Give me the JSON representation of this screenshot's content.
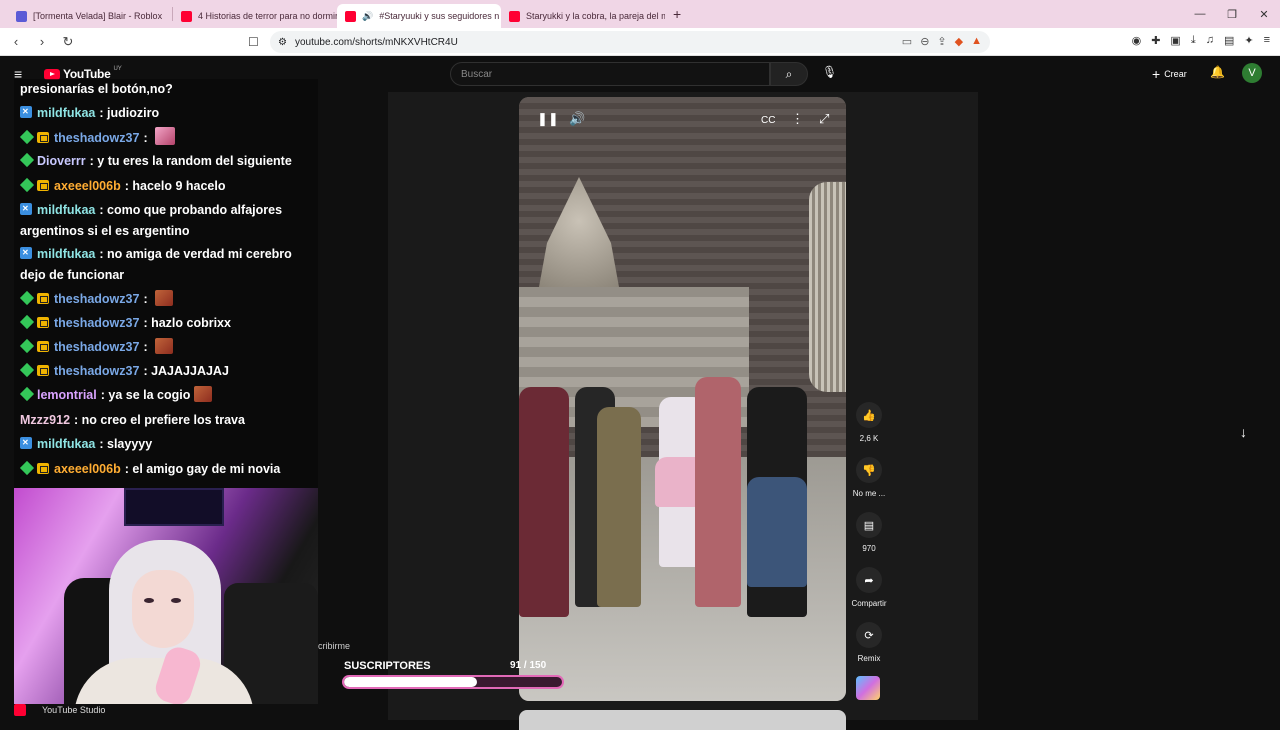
{
  "browser": {
    "tabs": [
      {
        "label": "[Tormenta Velada] Blair - Roblox",
        "active": false
      },
      {
        "label": "4 Historias de terror para no dormir |",
        "active": false
      },
      {
        "label": "#Staryuuki y sus seguidores n",
        "active": true
      },
      {
        "label": "Staryukki y la cobra, la pareja del mo",
        "active": false
      }
    ],
    "url": "youtube.com/shorts/mNKXVHtCR4U"
  },
  "youtube": {
    "logo_text": "YouTube",
    "country_code": "UY",
    "search_placeholder": "Buscar",
    "create_label": "Crear",
    "avatar_letter": "V"
  },
  "chat": [
    {
      "user": "",
      "text": "presionarías el botón,no?",
      "badges": []
    },
    {
      "user": "mildfukaa",
      "text": "judioziro",
      "badges": [
        "mod"
      ],
      "color": "#8fe4e4"
    },
    {
      "user": "theshadowz37",
      "text": "",
      "badges": [
        "sub",
        "crown"
      ],
      "color": "#7aa8e6",
      "emote": "pink"
    },
    {
      "user": "Dioverrr",
      "text": "y tu eres la random del siguiente",
      "badges": [
        "sub"
      ],
      "color": "#c9c9ff"
    },
    {
      "user": "axeeel006b",
      "text": "hacelo 9 hacelo",
      "badges": [
        "sub",
        "crown"
      ],
      "color": "#ffad33"
    },
    {
      "user": "mildfukaa",
      "text": "como que probando alfajores",
      "badges": [
        "mod"
      ],
      "color": "#8fe4e4"
    },
    {
      "user": "",
      "text": "argentinos si el es argentino",
      "badges": []
    },
    {
      "user": "mildfukaa",
      "text": "no amiga de verdad mi cerebro",
      "badges": [
        "mod"
      ],
      "color": "#8fe4e4"
    },
    {
      "user": "",
      "text": "dejo de funcionar",
      "badges": []
    },
    {
      "user": "theshadowz37",
      "text": "",
      "badges": [
        "sub",
        "crown"
      ],
      "color": "#7aa8e6",
      "emote": "orange"
    },
    {
      "user": "theshadowz37",
      "text": "hazlo cobrixx",
      "badges": [
        "sub",
        "crown"
      ],
      "color": "#7aa8e6"
    },
    {
      "user": "theshadowz37",
      "text": "",
      "badges": [
        "sub",
        "crown"
      ],
      "color": "#7aa8e6",
      "emote": "orange"
    },
    {
      "user": "theshadowz37",
      "text": "JAJAJJAJAJ",
      "badges": [
        "sub",
        "crown"
      ],
      "color": "#7aa8e6"
    },
    {
      "user": "lemontrial",
      "text": "ya se la cogio",
      "badges": [
        "sub"
      ],
      "color": "#d9a3ff",
      "emote": "orange"
    },
    {
      "user": "Mzzz912",
      "text": "no creo el prefiere los trava",
      "badges": [],
      "color": "#f0c8e0"
    },
    {
      "user": "mildfukaa",
      "text": "slayyyy",
      "badges": [
        "mod"
      ],
      "color": "#8fe4e4"
    },
    {
      "user": "axeeel006b",
      "text": "el amigo gay de mi novia",
      "badges": [
        "sub",
        "crown"
      ],
      "color": "#ffad33"
    }
  ],
  "actions": {
    "like_count": "2,6 K",
    "dislike_label": "No me ...",
    "comment_count": "970",
    "share_label": "Compartir",
    "remix_label": "Remix"
  },
  "overlay": {
    "subs_title": "SUSCRIPTORES",
    "subs_current": "91",
    "subs_sep": " / ",
    "subs_goal": "150",
    "subs_progress": 0.61,
    "subscribe_fragment": "cribirme",
    "studio_label": "YouTube Studio"
  },
  "colors": {
    "accent_pink": "#e26ab8",
    "yt_red": "#ff0033",
    "tab_bg": "#f0d6e6"
  }
}
